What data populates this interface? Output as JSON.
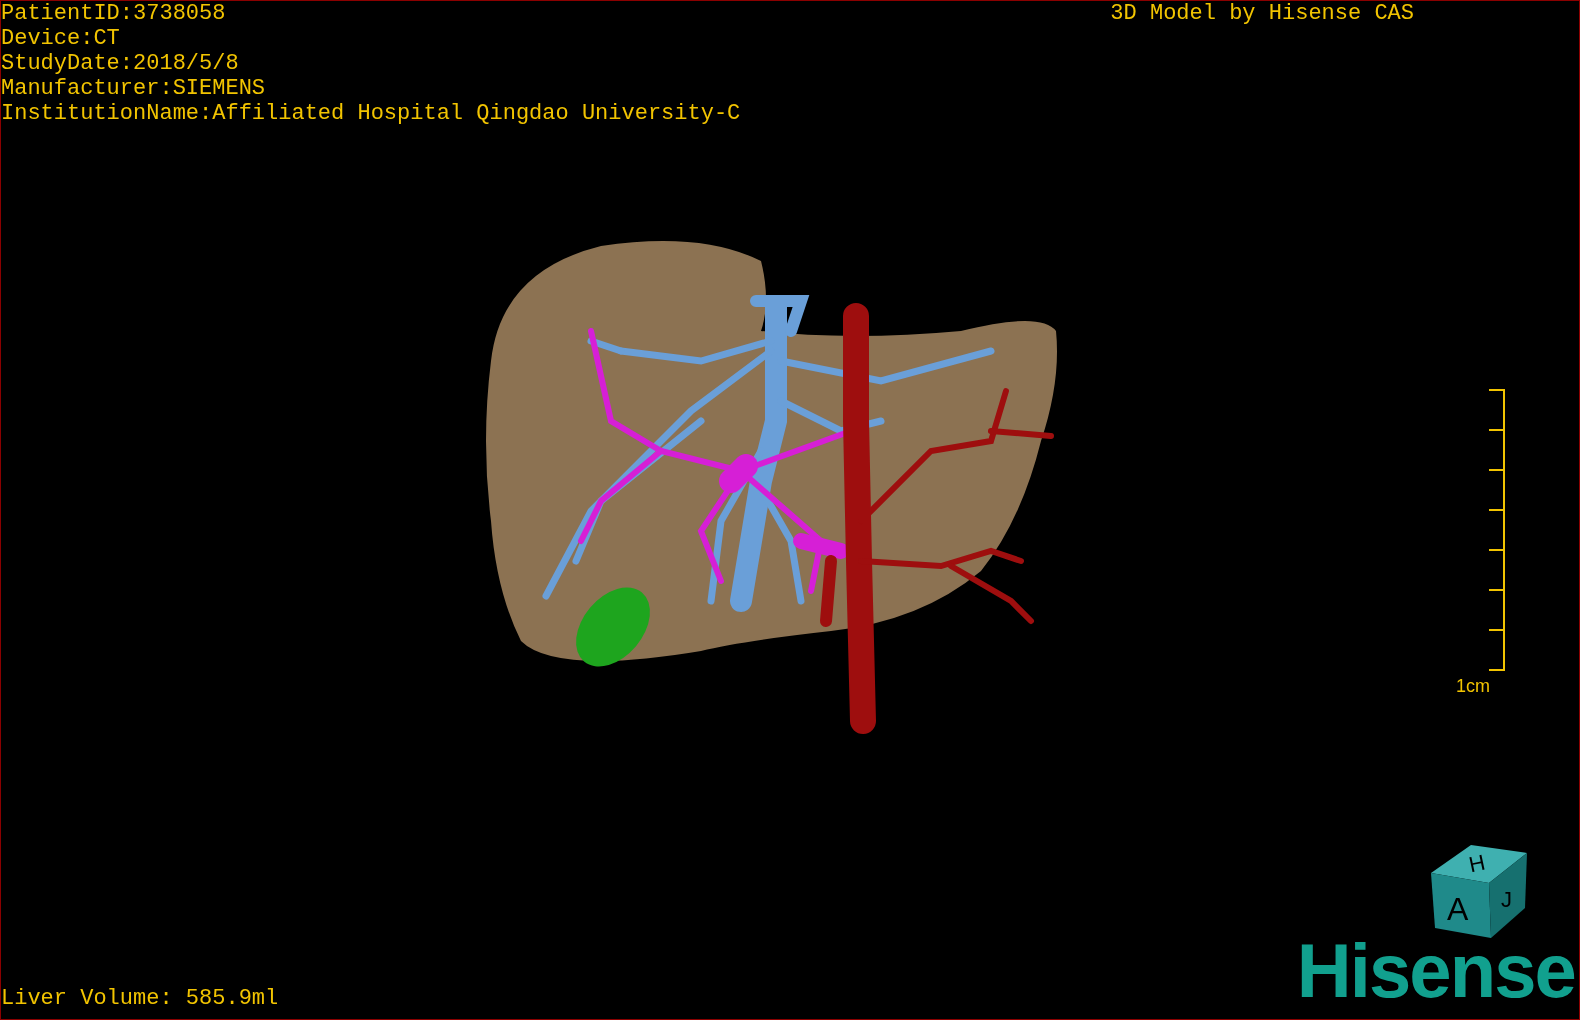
{
  "header_lines": [
    "PatientID:3738058",
    "Device:CT",
    "StudyDate:2018/5/8",
    "Manufacturer:SIEMENS",
    "InstitutionName:Affiliated Hospital Qingdao University-C"
  ],
  "title": "3D Model by Hisense CAS",
  "scale_bar": {
    "label": "1cm"
  },
  "orientation_cube": {
    "top": "H",
    "front": "A",
    "side": "J"
  },
  "logo": "Hisense",
  "liver_volume": "Liver Volume: 585.9ml"
}
